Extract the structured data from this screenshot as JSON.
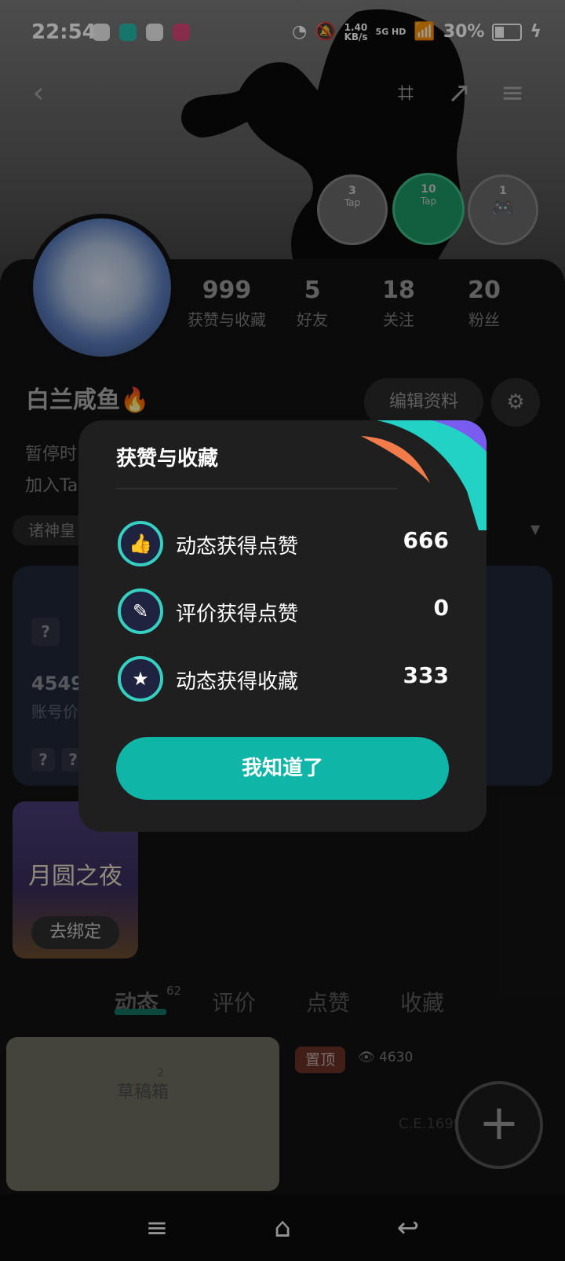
{
  "status_bar": {
    "time": "22:54",
    "net_speed": "1.40\nKB/s",
    "signal": "5G HD",
    "battery": "30%"
  },
  "profile": {
    "name": "白兰咸鱼🔥",
    "bio_line1": "暂停时",
    "bio_line2": "加入Ta",
    "edit_label": "编辑资料",
    "chip": "诸神皇",
    "stats": [
      {
        "num": "999",
        "label": "获赞与收藏"
      },
      {
        "num": "5",
        "label": "好友"
      },
      {
        "num": "18",
        "label": "关注"
      },
      {
        "num": "20",
        "label": "粉丝"
      }
    ],
    "badges": [
      {
        "num": "3",
        "text": "Tap"
      },
      {
        "num": "10",
        "text": "Tap"
      },
      {
        "num": "1",
        "text": ""
      }
    ]
  },
  "card": {
    "value": "4549",
    "label": "账号价",
    "q": "?"
  },
  "game": {
    "title": "月圆之夜",
    "unbind": "去绑定"
  },
  "tabs": [
    {
      "label": "动态",
      "count": "62"
    },
    {
      "label": "评价"
    },
    {
      "label": "点赞"
    },
    {
      "label": "收藏"
    }
  ],
  "posts": {
    "draft_label": "草稿箱",
    "draft_count": "2",
    "pin": "置顶",
    "views": "4630",
    "game_text": "C.E.1699"
  },
  "dialog": {
    "title": "获赞与收藏",
    "rows": [
      {
        "label": "动态获得点赞",
        "value": "666",
        "icon": "thumbs-up-icon"
      },
      {
        "label": "评价获得点赞",
        "value": "0",
        "icon": "pen-icon"
      },
      {
        "label": "动态获得收藏",
        "value": "333",
        "icon": "star-icon"
      }
    ],
    "ok": "我知道了"
  },
  "colors": {
    "accent": "#0fb5a7",
    "dialog_bg": "#1f1f1f"
  }
}
